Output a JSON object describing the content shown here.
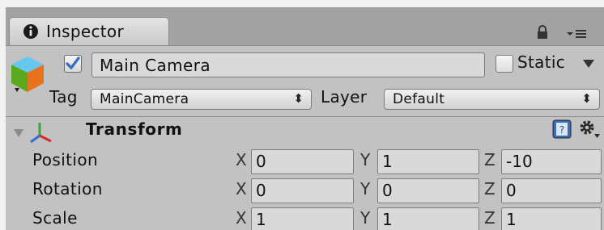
{
  "tab": {
    "label": "Inspector",
    "icon": "info-icon"
  },
  "window_controls": {
    "lock_icon": "lock-icon",
    "menu_icon": "context-menu-icon"
  },
  "game_object": {
    "icon": "gameobject-cube-icon",
    "active": true,
    "name": "Main Camera",
    "static_label": "Static",
    "static_checked": false,
    "tag_label": "Tag",
    "tag_value": "MainCamera",
    "layer_label": "Layer",
    "layer_value": "Default"
  },
  "component": {
    "title": "Transform",
    "icon": "transform-axes-icon",
    "rows": [
      {
        "label": "Position",
        "x": "0",
        "y": "1",
        "z": "-10"
      },
      {
        "label": "Rotation",
        "x": "0",
        "y": "0",
        "z": "0"
      },
      {
        "label": "Scale",
        "x": "1",
        "y": "1",
        "z": "1"
      }
    ],
    "axis_labels": {
      "x": "X",
      "y": "Y",
      "z": "Z"
    }
  },
  "colors": {
    "panel_bg": "#c2c2c2",
    "frame_bg": "#a2a2a2",
    "field_bg": "#d9d9d9",
    "check_blue": "#3b6fc2"
  }
}
